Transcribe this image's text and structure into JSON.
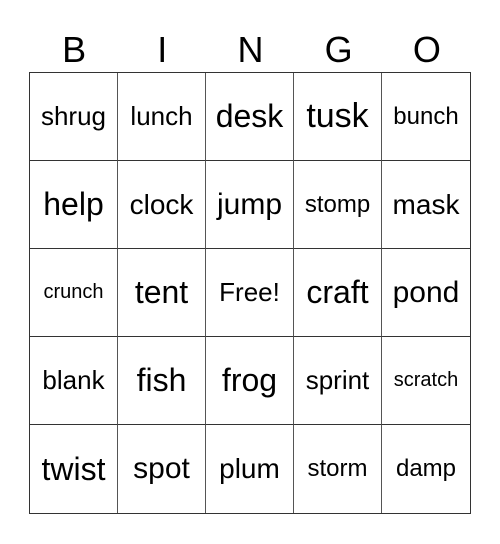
{
  "header": [
    "B",
    "I",
    "N",
    "G",
    "O"
  ],
  "cells": [
    [
      "shrug",
      "lunch",
      "desk",
      "tusk",
      "bunch"
    ],
    [
      "help",
      "clock",
      "jump",
      "stomp",
      "mask"
    ],
    [
      "crunch",
      "tent",
      "Free!",
      "craft",
      "pond"
    ],
    [
      "blank",
      "fish",
      "frog",
      "sprint",
      "scratch"
    ],
    [
      "twist",
      "spot",
      "plum",
      "storm",
      "damp"
    ]
  ]
}
